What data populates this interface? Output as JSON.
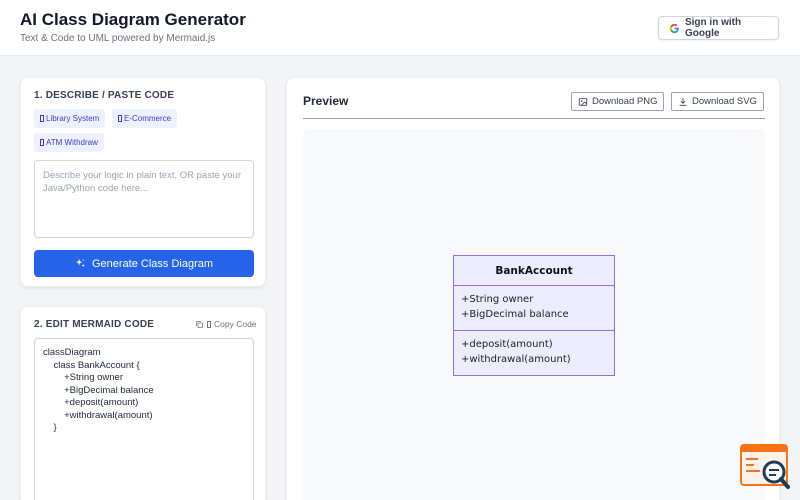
{
  "header": {
    "title": "AI Class Diagram Generator",
    "subtitle": "Text & Code to UML powered by Mermaid.js",
    "signin_label": "Sign in with Google"
  },
  "describe": {
    "title": "1. DESCRIBE / PASTE CODE",
    "chips": [
      {
        "label": "Library System"
      },
      {
        "label": "E-Commerce"
      },
      {
        "label": "ATM Withdraw"
      }
    ],
    "placeholder": "Describe your logic in plain text, OR paste your Java/Python code here...",
    "generate_label": "Generate Class Diagram"
  },
  "edit": {
    "title": "2. EDIT MERMAID CODE",
    "copy_label": "Copy Code",
    "code": "classDiagram\n    class BankAccount {\n        +String owner\n        +BigDecimal balance\n        +deposit(amount)\n        +withdrawal(amount)\n    }"
  },
  "preview": {
    "title": "Preview",
    "download_png_label": "Download PNG",
    "download_svg_label": "Download SVG",
    "diagram": {
      "class_name": "BankAccount",
      "attributes": [
        "+String owner",
        "+BigDecimal balance"
      ],
      "methods": [
        "+deposit(amount)",
        "+withdrawal(amount)"
      ]
    }
  },
  "colors": {
    "accent": "#2563eb",
    "chip_bg": "#eef2ff",
    "chip_text": "#4338ca",
    "uml_fill": "#ececff",
    "uml_stroke": "#9370db"
  },
  "icons": [
    "google-icon",
    "sparkles-icon",
    "copy-icon",
    "image-icon",
    "download-icon",
    "search-logo-icon"
  ]
}
